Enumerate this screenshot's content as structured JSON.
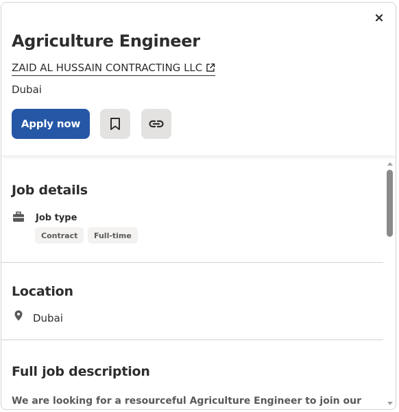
{
  "header": {
    "title": "Agriculture Engineer",
    "company": "ZAID AL HUSSAIN CONTRACTING LLC",
    "location": "Dubai",
    "apply_label": "Apply now",
    "icons": {
      "close": "close-icon",
      "external": "external-link-icon",
      "save": "bookmark-icon",
      "copy": "link-icon"
    }
  },
  "job_details": {
    "heading": "Job details",
    "job_type_label": "Job type",
    "job_types": [
      "Contract",
      "Full-time"
    ],
    "icon": "briefcase-icon"
  },
  "location_section": {
    "heading": "Location",
    "value": "Dubai",
    "icon": "map-pin-icon"
  },
  "description": {
    "heading": "Full job description",
    "first_line": "We are looking for a resourceful Agriculture Engineer to join our"
  },
  "colors": {
    "primary": "#2557a7",
    "icon_button_bg": "#e4e2e0",
    "pill_bg": "#f3f2f1",
    "text": "#2d2d2d"
  }
}
